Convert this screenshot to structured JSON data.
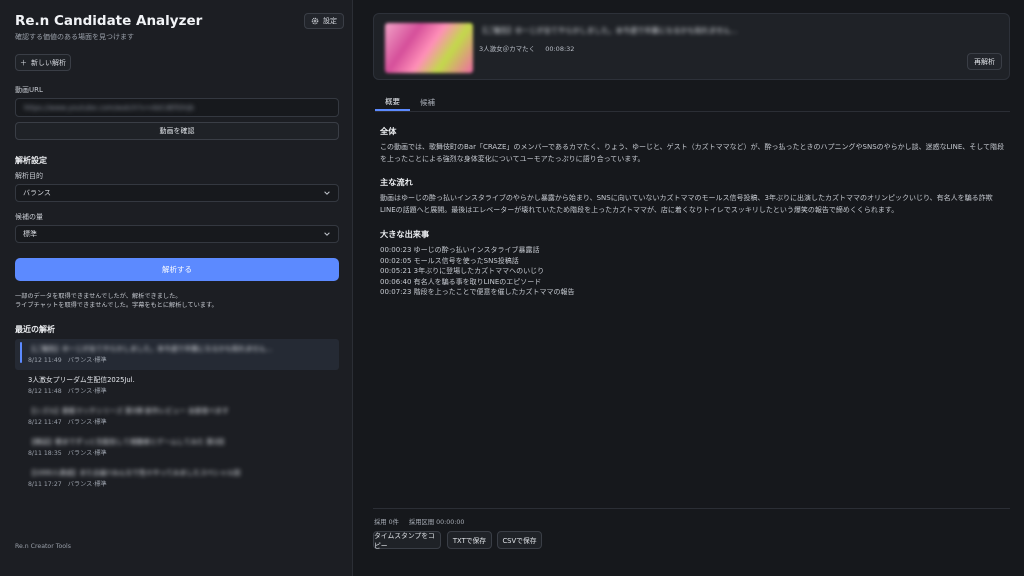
{
  "app": {
    "title": "Re.n Candidate Analyzer",
    "subtitle": "確認する価値のある場面を見つけます",
    "settings_label": "設定",
    "new_analysis_label": "新しい解析",
    "footer": "Re.n Creator Tools"
  },
  "url_section": {
    "label": "動画URL",
    "value": "https://www.youtube.com/watch?v=AbCdEfGhIjk",
    "check_button": "動画を確認"
  },
  "analysis_settings": {
    "heading": "解析設定",
    "purpose_label": "解析目的",
    "purpose_value": "バランス",
    "amount_label": "候補の量",
    "amount_value": "標準",
    "analyze_button": "解析する"
  },
  "notice": {
    "line1": "一部のデータを取得できませんでしたが、解析できました。",
    "line2": "ライブチャットを取得できませんでした。字幕をもとに解析しています。"
  },
  "recent": {
    "heading": "最近の解析",
    "items": [
      {
        "title": "【ご報告】ゆーじが全てやらかしました。本今週で卒業になるかも知れません…",
        "date": "8/12 11:49",
        "mode": "バランス",
        "amount": "標準"
      },
      {
        "title": "3人激女プリーダム生配信2025Jul.",
        "date": "8/12 11:48",
        "mode": "バランス",
        "amount": "標準"
      },
      {
        "title": "【シズル】鉄板マッチシリーズ 第3弾 新作レビュー 全部食べます",
        "date": "8/12 11:47",
        "mode": "バランス",
        "amount": "標準"
      },
      {
        "title": "【検証】朝までずっと生配信して視聴者とゲームしてみた 第2回",
        "date": "8/11 18:35",
        "mode": "バランス",
        "amount": "標準"
      },
      {
        "title": "【1000人達成】また企画!!みんなで色々やってみましたスペシャル回",
        "date": "8/11 17:27",
        "mode": "バランス",
        "amount": "標準"
      }
    ]
  },
  "video": {
    "title": "【ご報告】ゆーじが全てやらかしました。本今週で卒業になるかも知れません…",
    "channel": "3人激女＠カマたく",
    "duration": "00:08:32",
    "reanalyze_button": "再解析"
  },
  "tabs": [
    {
      "label": "概要"
    },
    {
      "label": "候補"
    }
  ],
  "summary": {
    "overall_heading": "全体",
    "overall_text": "この動画では、歌舞伎町のBar「CRAZE」のメンバーであるカマたく、りょう、ゆーじと、ゲスト（カズトママなど）が、酔っ払ったときのハプニングやSNSのやらかし談、迷惑なLINE、そして階段を上ったことによる強烈な身体変化についてユーモアたっぷりに語り合っています。",
    "flow_heading": "主な流れ",
    "flow_text": "動画はゆーじの酔っ払いインスタライブのやらかし暴露から始まり、SNSに向いていないカズトママのモールス信号投稿、3年ぶりに出演したカズトママのオリンピックいじり、有名人を騙る詐欺LINEの話題へと展開。最後はエレベーターが壊れていたため階段を上ったカズトママが、店に着くなりトイレでスッキリしたという爆笑の報告で締めくくられます。",
    "events_heading": "大きな出来事",
    "events": [
      "00:00:23 ゆーじの酔っ払いインスタライブ暴露話",
      "00:02:05 モールス信号を使ったSNS投稿話",
      "00:05:21 3年ぶりに登場したカズトママへのいじり",
      "00:06:40 有名人を騙る事を取りLINEのエピソード",
      "00:07:23 階段を上ったことで便意を催したカズトママの報告"
    ]
  },
  "bottom": {
    "adopted": "採用 0件",
    "range": "採用区間 00:00:00",
    "copy_button": "タイムスタンプをコピー",
    "txt_button": "TXTで保存",
    "csv_button": "CSVで保存"
  },
  "colors": {
    "accent": "#5c8aff",
    "background": "#16181c",
    "sidebar": "#1c1e23"
  }
}
